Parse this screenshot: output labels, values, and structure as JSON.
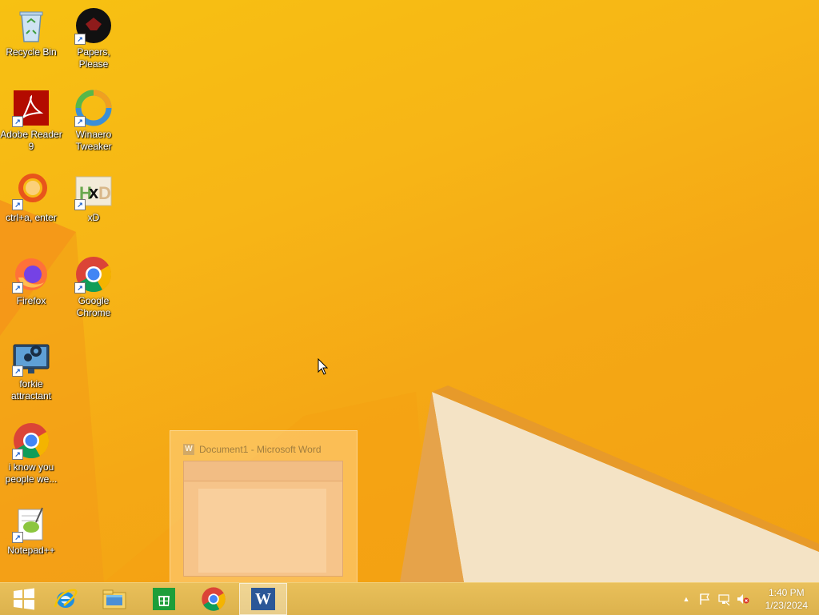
{
  "desktop": {
    "icons": [
      {
        "label": "Recycle Bin",
        "icon": "recycle-bin-icon"
      },
      {
        "label": "Papers, Please",
        "icon": "papers-please-icon"
      },
      {
        "label": "Adobe Reader 9",
        "icon": "adobe-reader-icon"
      },
      {
        "label": "Winaero Tweaker",
        "icon": "winaero-tweaker-icon"
      },
      {
        "label": "ctrl+a, enter",
        "icon": "orange-ring-icon"
      },
      {
        "label": "xD",
        "icon": "hxd-icon"
      },
      {
        "label": "Firefox",
        "icon": "firefox-icon"
      },
      {
        "label": "Google Chrome",
        "icon": "chrome-icon"
      },
      {
        "label": "forkie attractant",
        "icon": "computer-settings-icon"
      },
      {
        "label": "i know you people we...",
        "icon": "chrome-icon"
      },
      {
        "label": "Notepad++",
        "icon": "notepadpp-icon"
      }
    ]
  },
  "thumbnail": {
    "title": "Document1 - Microsoft Word",
    "app_letter": "W"
  },
  "taskbar": {
    "buttons": [
      {
        "name": "start",
        "icon": "windows-logo-icon"
      },
      {
        "name": "internet-explorer",
        "icon": "internet-explorer-icon"
      },
      {
        "name": "file-explorer",
        "icon": "file-explorer-icon"
      },
      {
        "name": "store",
        "icon": "store-icon"
      },
      {
        "name": "chrome",
        "icon": "chrome-icon"
      },
      {
        "name": "word",
        "icon": "word-icon",
        "letter": "W"
      }
    ],
    "tray": {
      "show_hidden": "▲",
      "icons": [
        "flag-icon",
        "network-icon",
        "volume-muted-icon"
      ]
    },
    "clock": {
      "time": "1:40 PM",
      "date": "1/23/2024"
    }
  },
  "colors": {
    "accent": "#f7b516",
    "taskbar": "#e3b953"
  }
}
